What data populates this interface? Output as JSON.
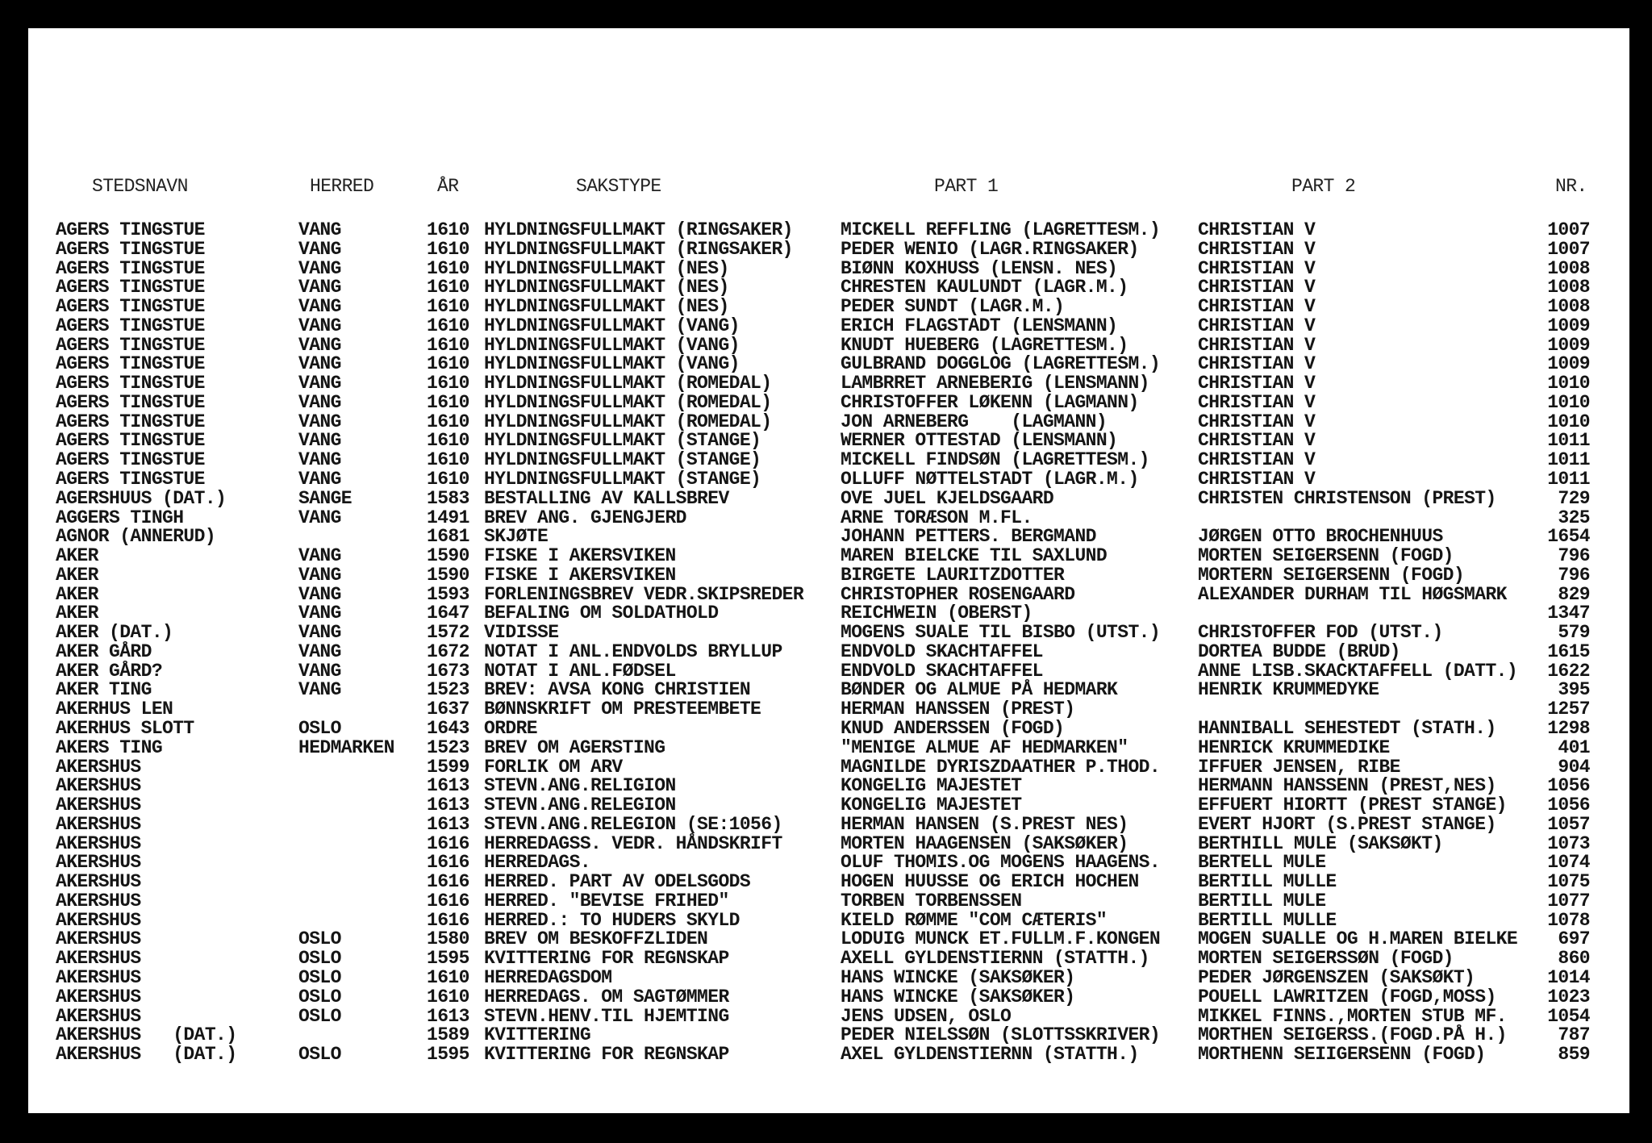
{
  "headers": {
    "stedsnavn": "STEDSNAVN",
    "herred": "HERRED",
    "aar": "ÅR",
    "sakstype": "SAKSTYPE",
    "part1": "PART 1",
    "part2": "PART 2",
    "nr": "NR."
  },
  "rows": [
    [
      "AGERS TINGSTUE",
      "VANG",
      "1610",
      "HYLDNINGSFULLMAKT (RINGSAKER)",
      "MICKELL REFFLING (LAGRETTESM.)",
      "CHRISTIAN V",
      "1007"
    ],
    [
      "AGERS TINGSTUE",
      "VANG",
      "1610",
      "HYLDNINGSFULLMAKT (RINGSAKER)",
      "PEDER WENIO (LAGR.RINGSAKER)",
      "CHRISTIAN V",
      "1007"
    ],
    [
      "AGERS TINGSTUE",
      "VANG",
      "1610",
      "HYLDNINGSFULLMAKT (NES)",
      "BIØNN KOXHUSS (LENSN. NES)",
      "CHRISTIAN V",
      "1008"
    ],
    [
      "AGERS TINGSTUE",
      "VANG",
      "1610",
      "HYLDNINGSFULLMAKT (NES)",
      "CHRESTEN KAULUNDT (LAGR.M.)",
      "CHRISTIAN V",
      "1008"
    ],
    [
      "AGERS TINGSTUE",
      "VANG",
      "1610",
      "HYLDNINGSFULLMAKT (NES)",
      "PEDER SUNDT (LAGR.M.)",
      "CHRISTIAN V",
      "1008"
    ],
    [
      "AGERS TINGSTUE",
      "VANG",
      "1610",
      "HYLDNINGSFULLMAKT (VANG)",
      "ERICH FLAGSTADT (LENSMANN)",
      "CHRISTIAN V",
      "1009"
    ],
    [
      "AGERS TINGSTUE",
      "VANG",
      "1610",
      "HYLDNINGSFULLMAKT (VANG)",
      "KNUDT HUEBERG (LAGRETTESM.)",
      "CHRISTIAN V",
      "1009"
    ],
    [
      "AGERS TINGSTUE",
      "VANG",
      "1610",
      "HYLDNINGSFULLMAKT (VANG)",
      "GULBRAND DOGGLOG (LAGRETTESM.)",
      "CHRISTIAN V",
      "1009"
    ],
    [
      "AGERS TINGSTUE",
      "VANG",
      "1610",
      "HYLDNINGSFULLMAKT (ROMEDAL)",
      "LAMBRRET ARNEBERIG (LENSMANN)",
      "CHRISTIAN V",
      "1010"
    ],
    [
      "AGERS TINGSTUE",
      "VANG",
      "1610",
      "HYLDNINGSFULLMAKT (ROMEDAL)",
      "CHRISTOFFER LØKENN (LAGMANN)",
      "CHRISTIAN V",
      "1010"
    ],
    [
      "AGERS TINGSTUE",
      "VANG",
      "1610",
      "HYLDNINGSFULLMAKT (ROMEDAL)",
      "JON ARNEBERG    (LAGMANN)",
      "CHRISTIAN V",
      "1010"
    ],
    [
      "AGERS TINGSTUE",
      "VANG",
      "1610",
      "HYLDNINGSFULLMAKT (STANGE)",
      "WERNER OTTESTAD (LENSMANN)",
      "CHRISTIAN V",
      "1011"
    ],
    [
      "AGERS TINGSTUE",
      "VANG",
      "1610",
      "HYLDNINGSFULLMAKT (STANGE)",
      "MICKELL FINDSØN (LAGRETTESM.)",
      "CHRISTIAN V",
      "1011"
    ],
    [
      "AGERS TINGSTUE",
      "VANG",
      "1610",
      "HYLDNINGSFULLMAKT (STANGE)",
      "OLLUFF NØTTELSTADT (LAGR.M.)",
      "CHRISTIAN V",
      "1011"
    ],
    [
      "AGERSHUUS (DAT.)",
      "SANGE",
      "1583",
      "BESTALLING AV KALLSBREV",
      "OVE JUEL KJELDSGAARD",
      "CHRISTEN CHRISTENSON (PREST)",
      "729"
    ],
    [
      "AGGERS TINGH",
      "VANG",
      "1491",
      "BREV ANG. GJENGJERD",
      "ARNE TORÆSON M.FL.",
      "",
      "325"
    ],
    [
      "AGNOR (ANNERUD)",
      "",
      "1681",
      "SKJØTE",
      "JOHANN PETTERS. BERGMAND",
      "JØRGEN OTTO BROCHENHUUS",
      "1654"
    ],
    [
      "AKER",
      "VANG",
      "1590",
      "FISKE I AKERSVIKEN",
      "MAREN BIELCKE TIL SAXLUND",
      "MORTEN SEIGERSENN (FOGD)",
      "796"
    ],
    [
      "AKER",
      "VANG",
      "1590",
      "FISKE I AKERSVIKEN",
      "BIRGETE LAURITZDOTTER",
      "MORTERN SEIGERSENN (FOGD)",
      "796"
    ],
    [
      "AKER",
      "VANG",
      "1593",
      "FORLENINGSBREV VEDR.SKIPSREDER",
      "CHRISTOPHER ROSENGAARD",
      "ALEXANDER DURHAM TIL HØGSMARK",
      "829"
    ],
    [
      "AKER",
      "VANG",
      "1647",
      "BEFALING OM SOLDATHOLD",
      "REICHWEIN (OBERST)",
      "",
      "1347"
    ],
    [
      "AKER (DAT.)",
      "VANG",
      "1572",
      "VIDISSE",
      "MOGENS SUALE TIL BISBO (UTST.)",
      "CHRISTOFFER FOD (UTST.)",
      "579"
    ],
    [
      "AKER GÅRD",
      "VANG",
      "1672",
      "NOTAT I ANL.ENDVOLDS BRYLLUP",
      "ENDVOLD SKACHTAFFEL",
      "DORTEA BUDDE (BRUD)",
      "1615"
    ],
    [
      "AKER GÅRD?",
      "VANG",
      "1673",
      "NOTAT I ANL.FØDSEL",
      "ENDVOLD SKACHTAFFEL",
      "ANNE LISB.SKACKTAFFELL (DATT.)",
      "1622"
    ],
    [
      "AKER TING",
      "VANG",
      "1523",
      "BREV: AVSA KONG CHRISTIEN",
      "BØNDER OG ALMUE PÅ HEDMARK",
      "HENRIK KRUMMEDYKE",
      "395"
    ],
    [
      "AKERHUS LEN",
      "",
      "1637",
      "BØNNSKRIFT OM PRESTEEMBETE",
      "HERMAN HANSSEN (PREST)",
      "",
      "1257"
    ],
    [
      "AKERHUS SLOTT",
      "OSLO",
      "1643",
      "ORDRE",
      "KNUD ANDERSSEN (FOGD)",
      "HANNIBALL SEHESTEDT (STATH.)",
      "1298"
    ],
    [
      "AKERS TING",
      "HEDMARKEN",
      "1523",
      "BREV OM AGERSTING",
      "\"MENIGE ALMUE AF HEDMARKEN\"",
      "HENRICK KRUMMEDIKE",
      "401"
    ],
    [
      "AKERSHUS",
      "",
      "1599",
      "FORLIK OM ARV",
      "MAGNILDE DYRISZDAATHER P.THOD.",
      "IFFUER JENSEN, RIBE",
      "904"
    ],
    [
      "AKERSHUS",
      "",
      "1613",
      "STEVN.ANG.RELIGION",
      "KONGELIG MAJESTET",
      "HERMANN HANSSENN (PREST,NES)",
      "1056"
    ],
    [
      "AKERSHUS",
      "",
      "1613",
      "STEVN.ANG.RELEGION",
      "KONGELIG MAJESTET",
      "EFFUERT HIORTT (PREST STANGE)",
      "1056"
    ],
    [
      "AKERSHUS",
      "",
      "1613",
      "STEVN.ANG.RELEGION (SE:1056)",
      "HERMAN HANSEN (S.PREST NES)",
      "EVERT HJORT (S.PREST STANGE)",
      "1057"
    ],
    [
      "AKERSHUS",
      "",
      "1616",
      "HERREDAGSS. VEDR. HÅNDSKRIFT",
      "MORTEN HAAGENSEN (SAKSØKER)",
      "BERTHILL MULE (SAKSØKT)",
      "1073"
    ],
    [
      "AKERSHUS",
      "",
      "1616",
      "HERREDAGS.",
      "OLUF THOMIS.OG MOGENS HAAGENS.",
      "BERTELL MULE",
      "1074"
    ],
    [
      "AKERSHUS",
      "",
      "1616",
      "HERRED. PART AV ODELSGODS",
      "HOGEN HUUSSE OG ERICH HOCHEN",
      "BERTILL MULLE",
      "1075"
    ],
    [
      "AKERSHUS",
      "",
      "1616",
      "HERRED. \"BEVISE FRIHED\"",
      "TORBEN TORBENSSEN",
      "BERTILL MULE",
      "1077"
    ],
    [
      "AKERSHUS",
      "",
      "1616",
      "HERRED.: TO HUDERS SKYLD",
      "KIELD RØMME \"COM CÆTERIS\"",
      "BERTILL MULLE",
      "1078"
    ],
    [
      "AKERSHUS",
      "OSLO",
      "1580",
      "BREV OM BESKOFFZLIDEN",
      "LODUIG MUNCK ET.FULLM.F.KONGEN",
      "MOGEN SUALLE OG H.MAREN BIELKE",
      "697"
    ],
    [
      "AKERSHUS",
      "OSLO",
      "1595",
      "KVITTERING FOR REGNSKAP",
      "AXELL GYLDENSTIERNN (STATTH.)",
      "MORTEN SEIGERSSØN (FOGD)",
      "860"
    ],
    [
      "AKERSHUS",
      "OSLO",
      "1610",
      "HERREDAGSDOM",
      "HANS WINCKE (SAKSØKER)",
      "PEDER JØRGENSZEN (SAKSØKT)",
      "1014"
    ],
    [
      "AKERSHUS",
      "OSLO",
      "1610",
      "HERREDAGS. OM SAGTØMMER",
      "HANS WINCKE (SAKSØKER)",
      "POUELL LAWRITZEN (FOGD,MOSS)",
      "1023"
    ],
    [
      "AKERSHUS",
      "OSLO",
      "1613",
      "STEVN.HENV.TIL HJEMTING",
      "JENS UDSEN, OSLO",
      "MIKKEL FINNS.,MORTEN STUB MF.",
      "1054"
    ],
    [
      "AKERSHUS   (DAT.)",
      "",
      "1589",
      "KVITTERING",
      "PEDER NIELSSØN (SLOTTSSKRIVER)",
      "MORTHEN SEIGERSS.(FOGD.PÅ H.)",
      "787"
    ],
    [
      "AKERSHUS   (DAT.)",
      "OSLO",
      "1595",
      "KVITTERING FOR REGNSKAP",
      "AXEL GYLDENSTIERNN (STATTH.)",
      "MORTHENN SEIIGERSENN (FOGD)",
      "859"
    ]
  ]
}
